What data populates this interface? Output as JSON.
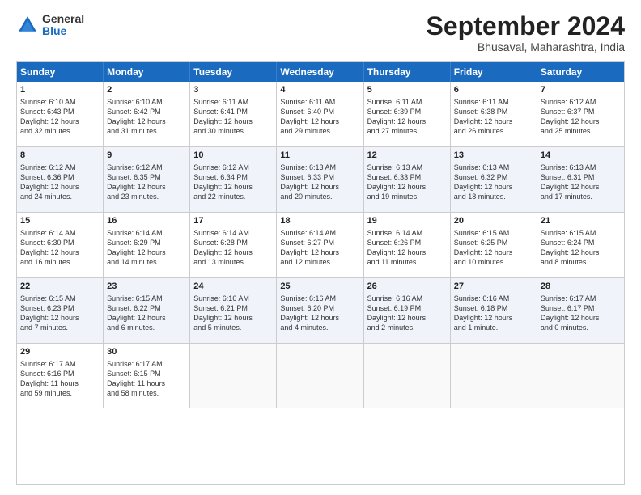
{
  "logo": {
    "general": "General",
    "blue": "Blue"
  },
  "title": "September 2024",
  "location": "Bhusaval, Maharashtra, India",
  "headers": [
    "Sunday",
    "Monday",
    "Tuesday",
    "Wednesday",
    "Thursday",
    "Friday",
    "Saturday"
  ],
  "rows": [
    [
      {
        "day": "",
        "lines": [],
        "empty": true
      },
      {
        "day": "2",
        "lines": [
          "Sunrise: 6:10 AM",
          "Sunset: 6:42 PM",
          "Daylight: 12 hours",
          "and 31 minutes."
        ]
      },
      {
        "day": "3",
        "lines": [
          "Sunrise: 6:11 AM",
          "Sunset: 6:41 PM",
          "Daylight: 12 hours",
          "and 30 minutes."
        ]
      },
      {
        "day": "4",
        "lines": [
          "Sunrise: 6:11 AM",
          "Sunset: 6:40 PM",
          "Daylight: 12 hours",
          "and 29 minutes."
        ]
      },
      {
        "day": "5",
        "lines": [
          "Sunrise: 6:11 AM",
          "Sunset: 6:39 PM",
          "Daylight: 12 hours",
          "and 27 minutes."
        ]
      },
      {
        "day": "6",
        "lines": [
          "Sunrise: 6:11 AM",
          "Sunset: 6:38 PM",
          "Daylight: 12 hours",
          "and 26 minutes."
        ]
      },
      {
        "day": "7",
        "lines": [
          "Sunrise: 6:12 AM",
          "Sunset: 6:37 PM",
          "Daylight: 12 hours",
          "and 25 minutes."
        ]
      }
    ],
    [
      {
        "day": "1",
        "lines": [
          "Sunrise: 6:10 AM",
          "Sunset: 6:43 PM",
          "Daylight: 12 hours",
          "and 32 minutes."
        ],
        "first": true
      },
      {
        "day": "8",
        "lines": [
          "Sunrise: 6:12 AM",
          "Sunset: 6:36 PM",
          "Daylight: 12 hours",
          "and 24 minutes."
        ]
      },
      {
        "day": "9",
        "lines": [
          "Sunrise: 6:12 AM",
          "Sunset: 6:35 PM",
          "Daylight: 12 hours",
          "and 23 minutes."
        ]
      },
      {
        "day": "10",
        "lines": [
          "Sunrise: 6:12 AM",
          "Sunset: 6:34 PM",
          "Daylight: 12 hours",
          "and 22 minutes."
        ]
      },
      {
        "day": "11",
        "lines": [
          "Sunrise: 6:13 AM",
          "Sunset: 6:33 PM",
          "Daylight: 12 hours",
          "and 20 minutes."
        ]
      },
      {
        "day": "12",
        "lines": [
          "Sunrise: 6:13 AM",
          "Sunset: 6:33 PM",
          "Daylight: 12 hours",
          "and 19 minutes."
        ]
      },
      {
        "day": "13",
        "lines": [
          "Sunrise: 6:13 AM",
          "Sunset: 6:32 PM",
          "Daylight: 12 hours",
          "and 18 minutes."
        ]
      },
      {
        "day": "14",
        "lines": [
          "Sunrise: 6:13 AM",
          "Sunset: 6:31 PM",
          "Daylight: 12 hours",
          "and 17 minutes."
        ]
      }
    ],
    [
      {
        "day": "15",
        "lines": [
          "Sunrise: 6:14 AM",
          "Sunset: 6:30 PM",
          "Daylight: 12 hours",
          "and 16 minutes."
        ]
      },
      {
        "day": "16",
        "lines": [
          "Sunrise: 6:14 AM",
          "Sunset: 6:29 PM",
          "Daylight: 12 hours",
          "and 14 minutes."
        ]
      },
      {
        "day": "17",
        "lines": [
          "Sunrise: 6:14 AM",
          "Sunset: 6:28 PM",
          "Daylight: 12 hours",
          "and 13 minutes."
        ]
      },
      {
        "day": "18",
        "lines": [
          "Sunrise: 6:14 AM",
          "Sunset: 6:27 PM",
          "Daylight: 12 hours",
          "and 12 minutes."
        ]
      },
      {
        "day": "19",
        "lines": [
          "Sunrise: 6:14 AM",
          "Sunset: 6:26 PM",
          "Daylight: 12 hours",
          "and 11 minutes."
        ]
      },
      {
        "day": "20",
        "lines": [
          "Sunrise: 6:15 AM",
          "Sunset: 6:25 PM",
          "Daylight: 12 hours",
          "and 10 minutes."
        ]
      },
      {
        "day": "21",
        "lines": [
          "Sunrise: 6:15 AM",
          "Sunset: 6:24 PM",
          "Daylight: 12 hours",
          "and 8 minutes."
        ]
      }
    ],
    [
      {
        "day": "22",
        "lines": [
          "Sunrise: 6:15 AM",
          "Sunset: 6:23 PM",
          "Daylight: 12 hours",
          "and 7 minutes."
        ]
      },
      {
        "day": "23",
        "lines": [
          "Sunrise: 6:15 AM",
          "Sunset: 6:22 PM",
          "Daylight: 12 hours",
          "and 6 minutes."
        ]
      },
      {
        "day": "24",
        "lines": [
          "Sunrise: 6:16 AM",
          "Sunset: 6:21 PM",
          "Daylight: 12 hours",
          "and 5 minutes."
        ]
      },
      {
        "day": "25",
        "lines": [
          "Sunrise: 6:16 AM",
          "Sunset: 6:20 PM",
          "Daylight: 12 hours",
          "and 4 minutes."
        ]
      },
      {
        "day": "26",
        "lines": [
          "Sunrise: 6:16 AM",
          "Sunset: 6:19 PM",
          "Daylight: 12 hours",
          "and 2 minutes."
        ]
      },
      {
        "day": "27",
        "lines": [
          "Sunrise: 6:16 AM",
          "Sunset: 6:18 PM",
          "Daylight: 12 hours",
          "and 1 minute."
        ]
      },
      {
        "day": "28",
        "lines": [
          "Sunrise: 6:17 AM",
          "Sunset: 6:17 PM",
          "Daylight: 12 hours",
          "and 0 minutes."
        ]
      }
    ],
    [
      {
        "day": "29",
        "lines": [
          "Sunrise: 6:17 AM",
          "Sunset: 6:16 PM",
          "Daylight: 11 hours",
          "and 59 minutes."
        ]
      },
      {
        "day": "30",
        "lines": [
          "Sunrise: 6:17 AM",
          "Sunset: 6:15 PM",
          "Daylight: 11 hours",
          "and 58 minutes."
        ]
      },
      {
        "day": "",
        "lines": [],
        "empty": true
      },
      {
        "day": "",
        "lines": [],
        "empty": true
      },
      {
        "day": "",
        "lines": [],
        "empty": true
      },
      {
        "day": "",
        "lines": [],
        "empty": true
      },
      {
        "day": "",
        "lines": [],
        "empty": true
      }
    ]
  ],
  "colors": {
    "header_bg": "#1a6bbf",
    "alt_row_bg": "#eef2fa"
  }
}
